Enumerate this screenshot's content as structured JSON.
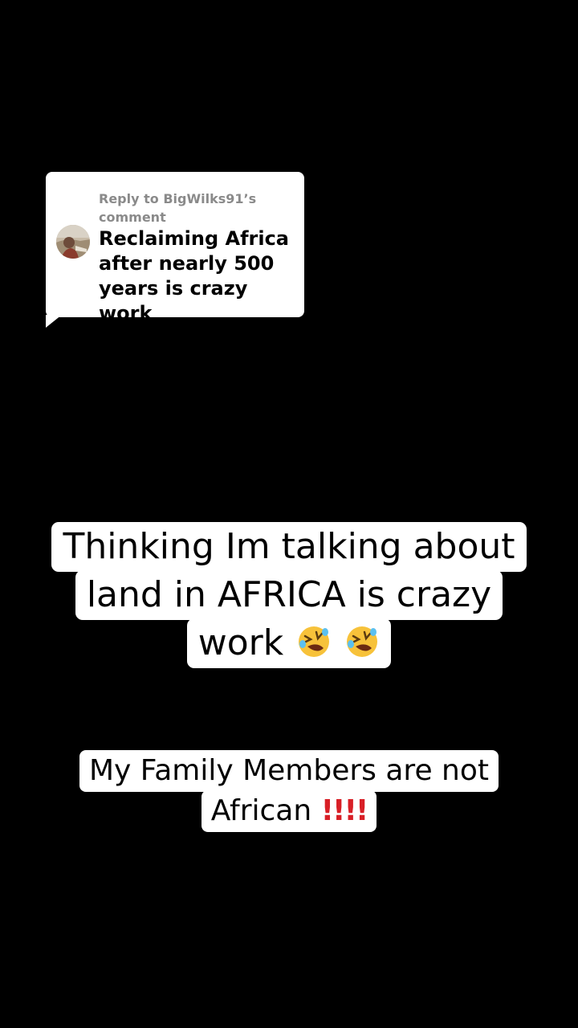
{
  "reply": {
    "header": "Reply to BigWilks91's comment",
    "header_line1": "Reply to BigWilks91’s",
    "header_line2": "comment",
    "text_line1": "Reclaiming Africa",
    "text_line2": "after nearly 500",
    "text_line3": "years is crazy work"
  },
  "caption_main": {
    "line1": "Thinking Im talking about",
    "line2": "land in AFRICA is crazy",
    "line3_text": "work",
    "line3_emoji": "🤣🤣",
    "emoji_icon": "rolling-on-floor-laughing-icon"
  },
  "caption_second": {
    "line1": "My Family Members are not",
    "line2_text": "African",
    "line2_emoji": "‼️‼️",
    "emoji_icon": "double-exclamation-icon"
  },
  "colors": {
    "background": "#000000",
    "bubble": "#ffffff",
    "reply_header": "#8a8a8a",
    "exclamation": "#d81f26"
  }
}
